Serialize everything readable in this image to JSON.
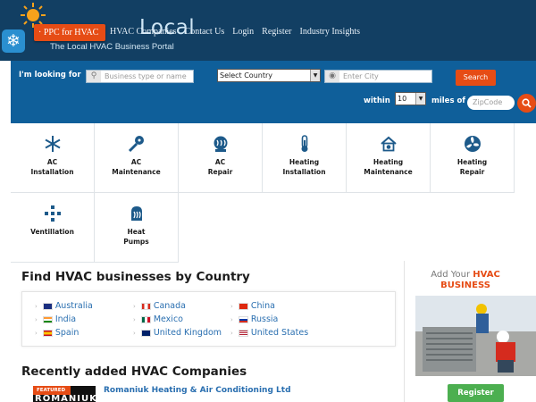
{
  "brand": {
    "logo_word": "Local",
    "tagline": "The Local HVAC Business Portal",
    "ppc_banner": "· PPC for HVAC"
  },
  "nav": {
    "items": [
      {
        "label": "HVAC Companies"
      },
      {
        "label": "Contact Us"
      },
      {
        "label": "Login"
      },
      {
        "label": "Register"
      },
      {
        "label": "Industry Insights"
      }
    ]
  },
  "search": {
    "looking_label": "I'm looking for",
    "business_placeholder": "Business type or name",
    "country_selected": "Select Country",
    "city_placeholder": "Enter City",
    "search_button": "Search",
    "within_label": "within",
    "radius_value": "10",
    "miles_label": "miles of",
    "zip_placeholder": "ZipCode"
  },
  "categories": [
    {
      "line1": "AC",
      "line2": "Installation",
      "icon": "snowflake-icon"
    },
    {
      "line1": "AC",
      "line2": "Maintenance",
      "icon": "wrench-fan-icon"
    },
    {
      "line1": "AC",
      "line2": "Repair",
      "icon": "ac-unit-icon"
    },
    {
      "line1": "Heating",
      "line2": "Installation",
      "icon": "thermometer-icon"
    },
    {
      "line1": "Heating",
      "line2": "Maintenance",
      "icon": "house-heat-icon"
    },
    {
      "line1": "Heating",
      "line2": "Repair",
      "icon": "fan-icon"
    },
    {
      "line1": "Ventillation",
      "line2": "",
      "icon": "vent-icon"
    },
    {
      "line1": "Heat",
      "line2": "Pumps",
      "icon": "heat-pump-icon"
    }
  ],
  "country_section": {
    "title": "Find HVAC businesses by Country",
    "countries": [
      {
        "name": "Australia",
        "flag": "flag-australia-icon"
      },
      {
        "name": "Canada",
        "flag": "flag-canada-icon"
      },
      {
        "name": "China",
        "flag": "flag-china-icon"
      },
      {
        "name": "India",
        "flag": "flag-india-icon"
      },
      {
        "name": "Mexico",
        "flag": "flag-mexico-icon"
      },
      {
        "name": "Russia",
        "flag": "flag-russia-icon"
      },
      {
        "name": "Spain",
        "flag": "flag-spain-icon"
      },
      {
        "name": "United Kingdom",
        "flag": "flag-uk-icon"
      },
      {
        "name": "United States",
        "flag": "flag-us-icon"
      }
    ]
  },
  "recent_section": {
    "title": "Recently added HVAC Companies",
    "featured_badge": "FEATURED",
    "featured_logo_text": "ROMANIUK",
    "company_name": "Romaniuk Heating & Air Conditioning Ltd"
  },
  "sidebar": {
    "add_prefix": "Add Your",
    "add_accent_1": "HVAC",
    "add_accent_2": "BUSINESS",
    "register_button": "Register"
  },
  "colors": {
    "header_bg": "#123f63",
    "search_band_bg": "#0f5f9a",
    "accent_orange": "#e64c15",
    "link_blue": "#2a6fb0",
    "register_green": "#4caf50"
  }
}
